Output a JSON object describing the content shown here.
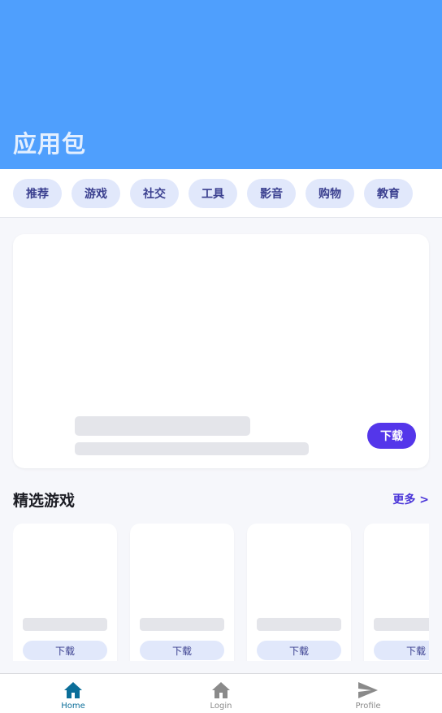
{
  "header": {
    "title": "应用包"
  },
  "tabs": [
    "推荐",
    "游戏",
    "社交",
    "工具",
    "影音",
    "购物",
    "教育"
  ],
  "hero": {
    "download_label": "下载"
  },
  "featured": {
    "title": "精选游戏",
    "more_label": "更多 >",
    "cards": [
      {
        "download_label": "下载"
      },
      {
        "download_label": "下载"
      },
      {
        "download_label": "下载"
      },
      {
        "download_label": "下载"
      }
    ]
  },
  "bottom_nav": {
    "items": [
      {
        "label": "Home",
        "icon": "home-icon",
        "active": true
      },
      {
        "label": "Login",
        "icon": "home-icon",
        "active": false
      },
      {
        "label": "Profile",
        "icon": "send-icon",
        "active": false
      }
    ]
  },
  "colors": {
    "header_bg": "#4f9ffd",
    "accent": "#5436ea",
    "tab_bg": "#e1e8fb",
    "nav_active": "#0b6e99",
    "nav_inactive": "#8a8a8a"
  }
}
